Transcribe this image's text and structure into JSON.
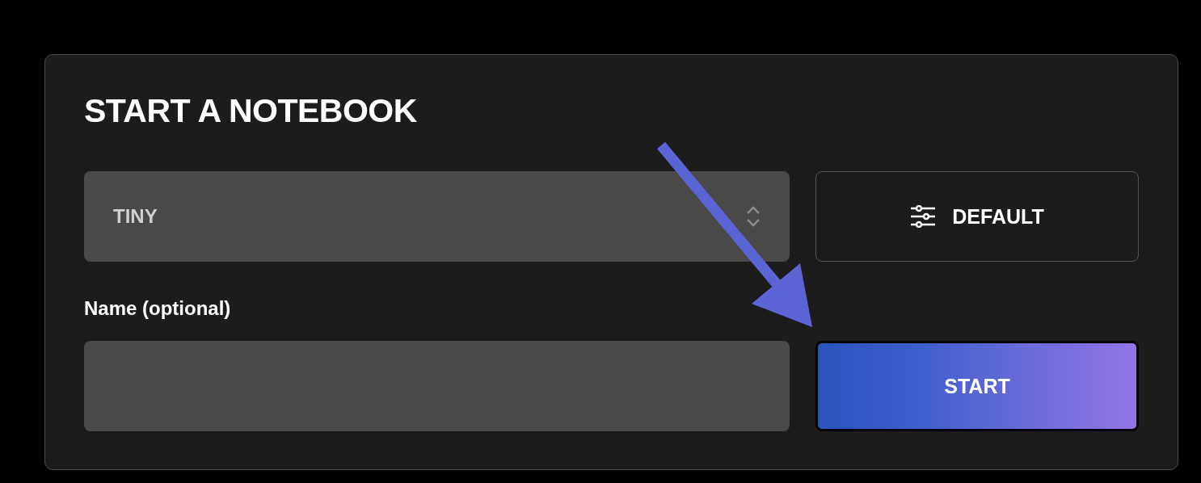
{
  "card": {
    "title": "START A NOTEBOOK",
    "size_select": {
      "value": "TINY"
    },
    "config_button": {
      "label": "DEFAULT"
    },
    "name_field": {
      "label": "Name (optional)"
    },
    "start_button": {
      "label": "START"
    }
  },
  "annotations": [
    {
      "kind": "arrow"
    }
  ]
}
